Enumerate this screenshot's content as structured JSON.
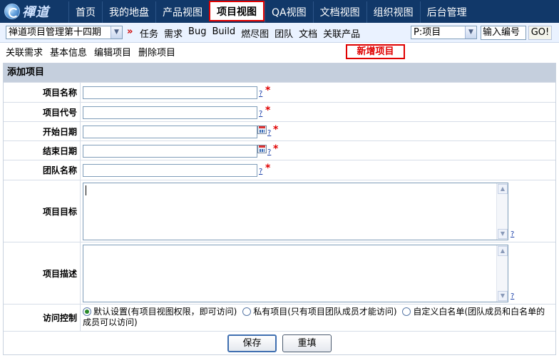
{
  "logo": {
    "text": "禪道"
  },
  "nav": {
    "tabs": [
      {
        "label": "首页",
        "active": false
      },
      {
        "label": "我的地盘",
        "active": false
      },
      {
        "label": "产品视图",
        "active": false
      },
      {
        "label": "项目视图",
        "active": true
      },
      {
        "label": "QA视图",
        "active": false
      },
      {
        "label": "文档视图",
        "active": false
      },
      {
        "label": "组织视图",
        "active": false
      },
      {
        "label": "后台管理",
        "active": false
      }
    ]
  },
  "subbar": {
    "project_select": "禅道项目管理第十四期",
    "separator": "»",
    "links": [
      "任务",
      "需求",
      "Bug",
      "Build",
      "燃尽图",
      "团队",
      "文档",
      "关联产品"
    ],
    "type_select": "P:项目",
    "code_input_value": "输入编号",
    "go_label": "GO!"
  },
  "actions": {
    "links": [
      "关联需求",
      "基本信息",
      "编辑项目",
      "删除项目"
    ],
    "page_title": "新增项目"
  },
  "form": {
    "header": "添加项目",
    "fields": {
      "name": {
        "label": "项目名称",
        "value": ""
      },
      "code": {
        "label": "项目代号",
        "value": ""
      },
      "begin": {
        "label": "开始日期",
        "value": ""
      },
      "end": {
        "label": "结束日期",
        "value": ""
      },
      "team": {
        "label": "团队名称",
        "value": ""
      },
      "goal": {
        "label": "项目目标",
        "value": ""
      },
      "desc": {
        "label": "项目描述",
        "value": ""
      }
    },
    "help_mark": "?",
    "required_mark": "*",
    "acl": {
      "label": "访问控制",
      "options": [
        {
          "label": "默认设置(有项目视图权限，即可访问)",
          "checked": true
        },
        {
          "label": "私有项目(只有项目团队成员才能访问)",
          "checked": false
        },
        {
          "label": "自定义白名单(团队成员和白名单的成员可以访问)",
          "checked": false
        }
      ]
    },
    "save_label": "保存",
    "reset_label": "重填"
  }
}
